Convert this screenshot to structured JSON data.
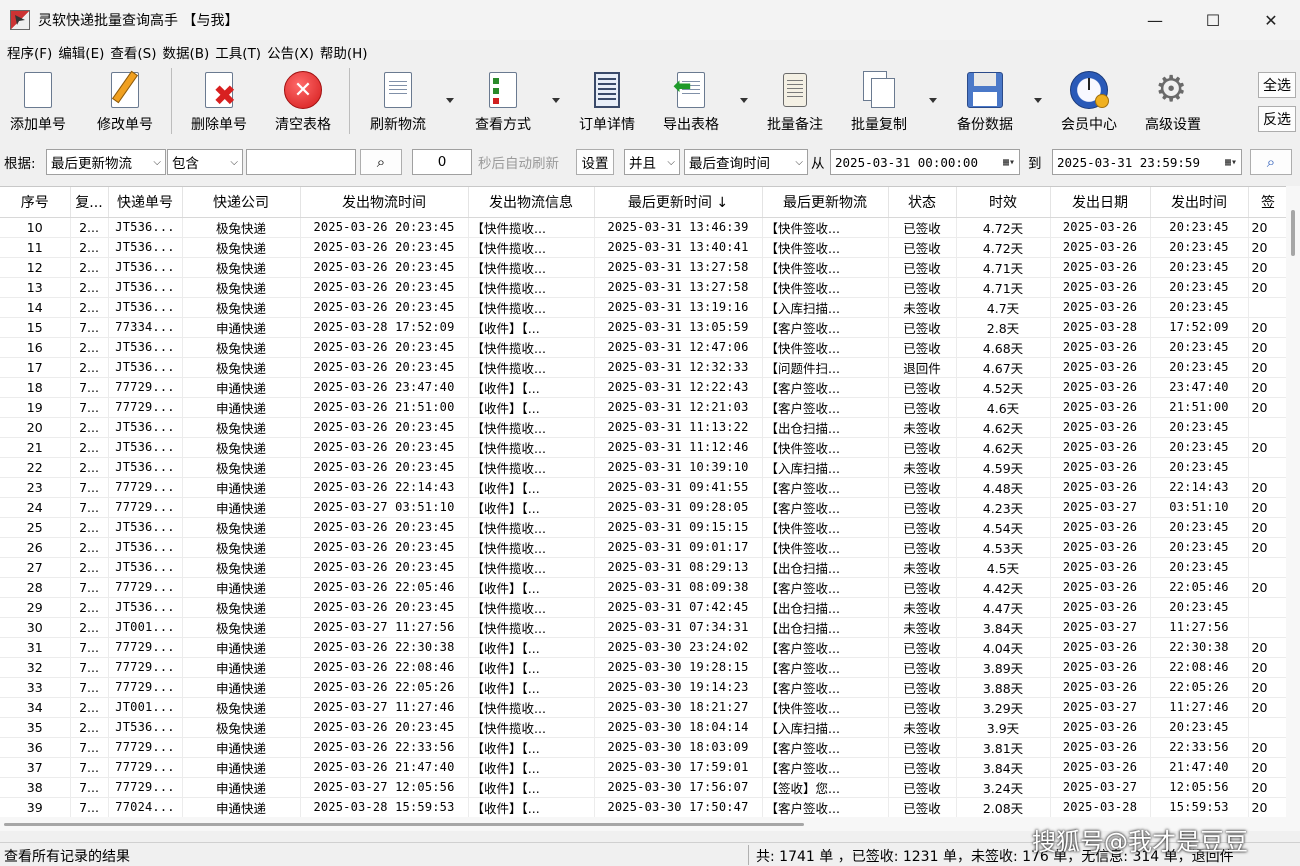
{
  "window": {
    "title": "灵软快递批量查询高手 【与我】",
    "minimize": "—",
    "maximize": "☐",
    "close": "✕"
  },
  "menu": [
    "程序(F)",
    "编辑(E)",
    "查看(S)",
    "数据(B)",
    "工具(T)",
    "公告(X)",
    "帮助(H)"
  ],
  "toolbar": {
    "add": "添加单号",
    "edit": "修改单号",
    "delete": "删除单号",
    "clear": "清空表格",
    "refresh": "刷新物流",
    "view_mode": "查看方式",
    "order_detail": "订单详情",
    "export": "导出表格",
    "batch_note": "批量备注",
    "batch_copy": "批量复制",
    "backup": "备份数据",
    "member": "会员中心",
    "advanced": "高级设置",
    "select_all": "全选",
    "invert": "反选"
  },
  "filter": {
    "by_label": "根据:",
    "field": "最后更新物流",
    "op": "包含",
    "keyword": "",
    "seconds": "0",
    "auto_refresh": "秒后自动刷新",
    "settings": "设置",
    "logic": "并且",
    "time_field": "最后查询时间",
    "from_label": "从",
    "from": "2025-03-31  00:00:00",
    "to_label": "到",
    "to": "2025-03-31  23:59:59"
  },
  "table": {
    "columns": [
      "序号",
      "复...",
      "快递单号",
      "快递公司",
      "发出物流时间",
      "发出物流信息",
      "最后更新时间 ↓",
      "最后更新物流",
      "状态",
      "时效",
      "发出日期",
      "发出时间",
      "签"
    ],
    "rows": [
      [
        "10",
        "2...",
        "JT536...",
        "极兔快递",
        "2025-03-26 20:23:45",
        "【快件揽收...",
        "2025-03-31 13:46:39",
        "【快件签收...",
        "已签收",
        "4.72天",
        "2025-03-26",
        "20:23:45",
        "20"
      ],
      [
        "11",
        "2...",
        "JT536...",
        "极兔快递",
        "2025-03-26 20:23:45",
        "【快件揽收...",
        "2025-03-31 13:40:41",
        "【快件签收...",
        "已签收",
        "4.72天",
        "2025-03-26",
        "20:23:45",
        "20"
      ],
      [
        "12",
        "2...",
        "JT536...",
        "极兔快递",
        "2025-03-26 20:23:45",
        "【快件揽收...",
        "2025-03-31 13:27:58",
        "【快件签收...",
        "已签收",
        "4.71天",
        "2025-03-26",
        "20:23:45",
        "20"
      ],
      [
        "13",
        "2...",
        "JT536...",
        "极兔快递",
        "2025-03-26 20:23:45",
        "【快件揽收...",
        "2025-03-31 13:27:58",
        "【快件签收...",
        "已签收",
        "4.71天",
        "2025-03-26",
        "20:23:45",
        "20"
      ],
      [
        "14",
        "2...",
        "JT536...",
        "极兔快递",
        "2025-03-26 20:23:45",
        "【快件揽收...",
        "2025-03-31 13:19:16",
        "【入库扫描...",
        "未签收",
        "4.7天",
        "2025-03-26",
        "20:23:45",
        ""
      ],
      [
        "15",
        "7...",
        "77334...",
        "申通快递",
        "2025-03-28 17:52:09",
        "【收件】【...",
        "2025-03-31 13:05:59",
        "【客户签收...",
        "已签收",
        "2.8天",
        "2025-03-28",
        "17:52:09",
        "20"
      ],
      [
        "16",
        "2...",
        "JT536...",
        "极兔快递",
        "2025-03-26 20:23:45",
        "【快件揽收...",
        "2025-03-31 12:47:06",
        "【快件签收...",
        "已签收",
        "4.68天",
        "2025-03-26",
        "20:23:45",
        "20"
      ],
      [
        "17",
        "2...",
        "JT536...",
        "极兔快递",
        "2025-03-26 20:23:45",
        "【快件揽收...",
        "2025-03-31 12:32:33",
        "【问题件扫...",
        "退回件",
        "4.67天",
        "2025-03-26",
        "20:23:45",
        "20"
      ],
      [
        "18",
        "7...",
        "77729...",
        "申通快递",
        "2025-03-26 23:47:40",
        "【收件】【...",
        "2025-03-31 12:22:43",
        "【客户签收...",
        "已签收",
        "4.52天",
        "2025-03-26",
        "23:47:40",
        "20"
      ],
      [
        "19",
        "7...",
        "77729...",
        "申通快递",
        "2025-03-26 21:51:00",
        "【收件】【...",
        "2025-03-31 12:21:03",
        "【客户签收...",
        "已签收",
        "4.6天",
        "2025-03-26",
        "21:51:00",
        "20"
      ],
      [
        "20",
        "2...",
        "JT536...",
        "极兔快递",
        "2025-03-26 20:23:45",
        "【快件揽收...",
        "2025-03-31 11:13:22",
        "【出仓扫描...",
        "未签收",
        "4.62天",
        "2025-03-26",
        "20:23:45",
        ""
      ],
      [
        "21",
        "2...",
        "JT536...",
        "极兔快递",
        "2025-03-26 20:23:45",
        "【快件揽收...",
        "2025-03-31 11:12:46",
        "【快件签收...",
        "已签收",
        "4.62天",
        "2025-03-26",
        "20:23:45",
        "20"
      ],
      [
        "22",
        "2...",
        "JT536...",
        "极兔快递",
        "2025-03-26 20:23:45",
        "【快件揽收...",
        "2025-03-31 10:39:10",
        "【入库扫描...",
        "未签收",
        "4.59天",
        "2025-03-26",
        "20:23:45",
        ""
      ],
      [
        "23",
        "7...",
        "77729...",
        "申通快递",
        "2025-03-26 22:14:43",
        "【收件】【...",
        "2025-03-31 09:41:55",
        "【客户签收...",
        "已签收",
        "4.48天",
        "2025-03-26",
        "22:14:43",
        "20"
      ],
      [
        "24",
        "7...",
        "77729...",
        "申通快递",
        "2025-03-27 03:51:10",
        "【收件】【...",
        "2025-03-31 09:28:05",
        "【客户签收...",
        "已签收",
        "4.23天",
        "2025-03-27",
        "03:51:10",
        "20"
      ],
      [
        "25",
        "2...",
        "JT536...",
        "极兔快递",
        "2025-03-26 20:23:45",
        "【快件揽收...",
        "2025-03-31 09:15:15",
        "【快件签收...",
        "已签收",
        "4.54天",
        "2025-03-26",
        "20:23:45",
        "20"
      ],
      [
        "26",
        "2...",
        "JT536...",
        "极兔快递",
        "2025-03-26 20:23:45",
        "【快件揽收...",
        "2025-03-31 09:01:17",
        "【快件签收...",
        "已签收",
        "4.53天",
        "2025-03-26",
        "20:23:45",
        "20"
      ],
      [
        "27",
        "2...",
        "JT536...",
        "极兔快递",
        "2025-03-26 20:23:45",
        "【快件揽收...",
        "2025-03-31 08:29:13",
        "【出仓扫描...",
        "未签收",
        "4.5天",
        "2025-03-26",
        "20:23:45",
        ""
      ],
      [
        "28",
        "7...",
        "77729...",
        "申通快递",
        "2025-03-26 22:05:46",
        "【收件】【...",
        "2025-03-31 08:09:38",
        "【客户签收...",
        "已签收",
        "4.42天",
        "2025-03-26",
        "22:05:46",
        "20"
      ],
      [
        "29",
        "2...",
        "JT536...",
        "极兔快递",
        "2025-03-26 20:23:45",
        "【快件揽收...",
        "2025-03-31 07:42:45",
        "【出仓扫描...",
        "未签收",
        "4.47天",
        "2025-03-26",
        "20:23:45",
        ""
      ],
      [
        "30",
        "2...",
        "JT001...",
        "极兔快递",
        "2025-03-27 11:27:56",
        "【快件揽收...",
        "2025-03-31 07:34:31",
        "【出仓扫描...",
        "未签收",
        "3.84天",
        "2025-03-27",
        "11:27:56",
        ""
      ],
      [
        "31",
        "7...",
        "77729...",
        "申通快递",
        "2025-03-26 22:30:38",
        "【收件】【...",
        "2025-03-30 23:24:02",
        "【客户签收...",
        "已签收",
        "4.04天",
        "2025-03-26",
        "22:30:38",
        "20"
      ],
      [
        "32",
        "7...",
        "77729...",
        "申通快递",
        "2025-03-26 22:08:46",
        "【收件】【...",
        "2025-03-30 19:28:15",
        "【客户签收...",
        "已签收",
        "3.89天",
        "2025-03-26",
        "22:08:46",
        "20"
      ],
      [
        "33",
        "7...",
        "77729...",
        "申通快递",
        "2025-03-26 22:05:26",
        "【收件】【...",
        "2025-03-30 19:14:23",
        "【客户签收...",
        "已签收",
        "3.88天",
        "2025-03-26",
        "22:05:26",
        "20"
      ],
      [
        "34",
        "2...",
        "JT001...",
        "极兔快递",
        "2025-03-27 11:27:46",
        "【快件揽收...",
        "2025-03-30 18:21:27",
        "【快件签收...",
        "已签收",
        "3.29天",
        "2025-03-27",
        "11:27:46",
        "20"
      ],
      [
        "35",
        "2...",
        "JT536...",
        "极兔快递",
        "2025-03-26 20:23:45",
        "【快件揽收...",
        "2025-03-30 18:04:14",
        "【入库扫描...",
        "未签收",
        "3.9天",
        "2025-03-26",
        "20:23:45",
        ""
      ],
      [
        "36",
        "7...",
        "77729...",
        "申通快递",
        "2025-03-26 22:33:56",
        "【收件】【...",
        "2025-03-30 18:03:09",
        "【客户签收...",
        "已签收",
        "3.81天",
        "2025-03-26",
        "22:33:56",
        "20"
      ],
      [
        "37",
        "7...",
        "77729...",
        "申通快递",
        "2025-03-26 21:47:40",
        "【收件】【...",
        "2025-03-30 17:59:01",
        "【客户签收...",
        "已签收",
        "3.84天",
        "2025-03-26",
        "21:47:40",
        "20"
      ],
      [
        "38",
        "7...",
        "77729...",
        "申通快递",
        "2025-03-27 12:05:56",
        "【收件】【...",
        "2025-03-30 17:56:07",
        "【签收】您...",
        "已签收",
        "3.24天",
        "2025-03-27",
        "12:05:56",
        "20"
      ],
      [
        "39",
        "7...",
        "77024...",
        "申通快递",
        "2025-03-28 15:59:53",
        "【收件】【...",
        "2025-03-30 17:50:47",
        "【客户签收...",
        "已签收",
        "2.08天",
        "2025-03-28",
        "15:59:53",
        "20"
      ]
    ]
  },
  "status": {
    "left": "查看所有记录的结果",
    "right": "共: 1741 单 ，已签收:  1231 单，未签收:  176 单，无信息:  314 单，退回件",
    "watermark": "搜狐号@我才是豆豆"
  }
}
